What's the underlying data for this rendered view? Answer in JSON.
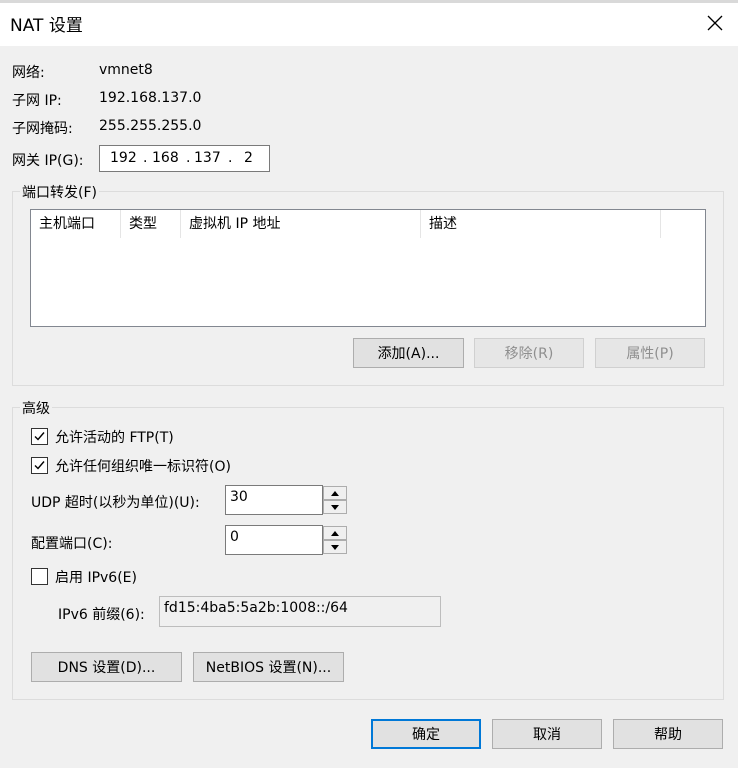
{
  "window": {
    "title": "NAT 设置"
  },
  "info": {
    "network_label": "网络:",
    "network_value": "vmnet8",
    "subnet_ip_label": "子网 IP:",
    "subnet_ip_value": "192.168.137.0",
    "subnet_mask_label": "子网掩码:",
    "subnet_mask_value": "255.255.255.0",
    "gateway_label": "网关 IP(G):",
    "gateway_octets": [
      "192",
      "168",
      "137",
      "2"
    ]
  },
  "port_forwarding": {
    "title": "端口转发(F)",
    "columns": [
      "主机端口",
      "类型",
      "虚拟机 IP 地址",
      "描述"
    ],
    "rows": [],
    "add_label": "添加(A)...",
    "remove_label": "移除(R)",
    "properties_label": "属性(P)"
  },
  "advanced": {
    "title": "高级",
    "allow_ftp": {
      "label": "允许活动的 FTP(T)",
      "checked": true
    },
    "allow_oui": {
      "label": "允许任何组织唯一标识符(O)",
      "checked": true
    },
    "udp_timeout_label": "UDP 超时(以秒为单位)(U):",
    "udp_timeout_value": "30",
    "config_port_label": "配置端口(C):",
    "config_port_value": "0",
    "enable_ipv6": {
      "label": "启用 IPv6(E)",
      "checked": false
    },
    "ipv6_prefix_label": "IPv6 前缀(6):",
    "ipv6_prefix_value": "fd15:4ba5:5a2b:1008::/64",
    "dns_label": "DNS 设置(D)...",
    "netbios_label": "NetBIOS 设置(N)..."
  },
  "footer": {
    "ok_label": "确定",
    "cancel_label": "取消",
    "help_label": "帮助"
  }
}
